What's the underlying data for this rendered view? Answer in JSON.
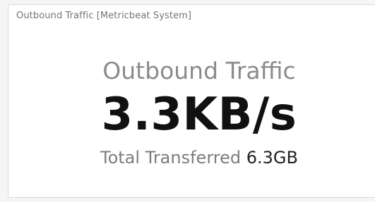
{
  "panel": {
    "title": "Outbound Traffic [Metricbeat System]"
  },
  "metric": {
    "label": "Outbound Traffic",
    "value": "3.3KB/s",
    "sub_label": "Total Transferred",
    "sub_value": "6.3GB"
  },
  "colors": {
    "background": "#f5f5f5",
    "panel_background": "#ffffff",
    "title_text": "#6f7780",
    "label_text": "#8b8b8b",
    "value_text": "#111111"
  }
}
